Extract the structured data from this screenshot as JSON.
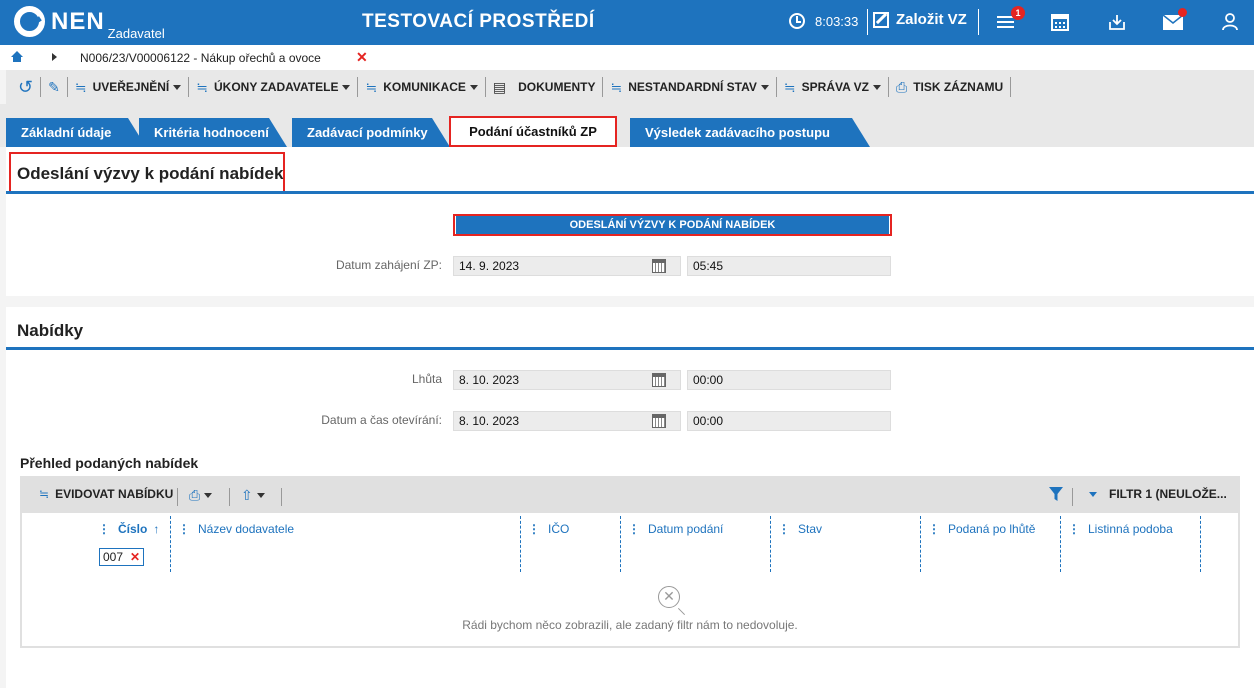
{
  "header": {
    "logo": "NEN",
    "logo_sub": "Zadavatel",
    "title": "TESTOVACÍ PROSTŘEDÍ",
    "time": "8:03:33",
    "create_label": "Založit VZ",
    "menu_badge": "1"
  },
  "breadcrumb": {
    "path": "N006/23/V00006122 - Nákup ořechů a ovoce"
  },
  "toolbar": {
    "publish": "UVEŘEJNĚNÍ",
    "actions": "ÚKONY ZADAVATELE",
    "communication": "KOMUNIKACE",
    "documents": "DOKUMENTY",
    "nonstandard": "NESTANDARDNÍ STAV",
    "management": "SPRÁVA VZ",
    "print": "TISK ZÁZNAMU"
  },
  "tabs": [
    {
      "label": "Základní údaje"
    },
    {
      "label": "Kritéria hodnocení"
    },
    {
      "label": "Zadávací podmínky"
    },
    {
      "label": "Podání účastníků ZP"
    },
    {
      "label": "Výsledek zadávacího postupu"
    }
  ],
  "invitation": {
    "title": "Odeslání výzvy k podání nabídek",
    "button": "ODESLÁNÍ VÝZVY K PODÁNÍ NABÍDEK",
    "start_label": "Datum zahájení ZP:",
    "start_date": "14. 9. 2023",
    "start_time": "05:45"
  },
  "offers": {
    "title": "Nabídky",
    "deadline_label": "Lhůta",
    "deadline_date": "8. 10. 2023",
    "deadline_time": "00:00",
    "opening_label": "Datum a čas otevírání:",
    "opening_date": "8. 10. 2023",
    "opening_time": "00:00"
  },
  "grid": {
    "title": "Přehled podaných nabídek",
    "register": "EVIDOVAT NABÍDKU",
    "filter": "FILTR 1 (NEULOŽE...",
    "columns": [
      "Číslo",
      "Název dodavatele",
      "IČO",
      "Datum podání",
      "Stav",
      "Podaná po lhůtě",
      "Listinná podoba"
    ],
    "filter_value": "007",
    "empty_text": "Rádi bychom něco zobrazili, ale zadaný filtr nám to nedovoluje."
  }
}
